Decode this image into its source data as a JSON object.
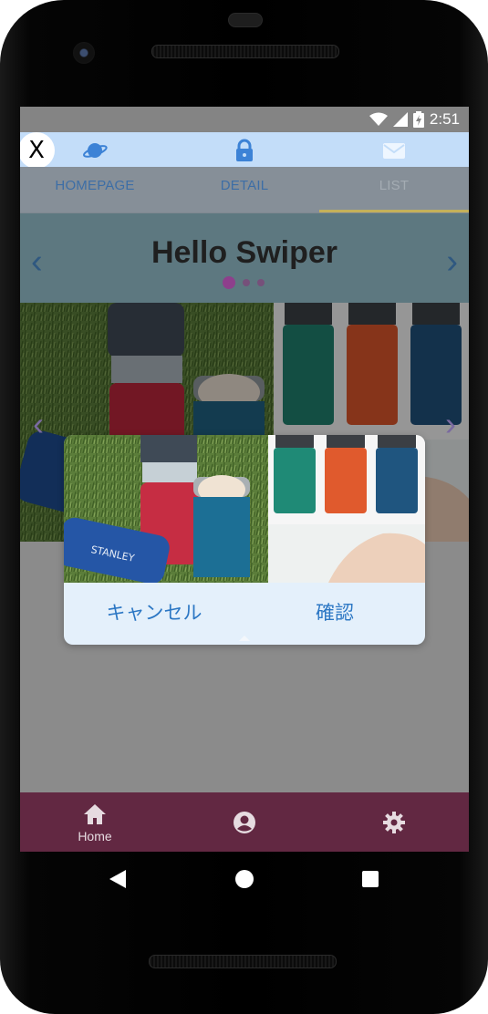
{
  "status_bar": {
    "time": "2:51"
  },
  "top_nav": {
    "close_label": "X",
    "icons": [
      "planet-icon",
      "lock-icon",
      "mail-icon"
    ]
  },
  "tabs": [
    {
      "label": "HOMEPAGE",
      "active": false
    },
    {
      "label": "DETAIL",
      "active": false
    },
    {
      "label": "LIST",
      "active": true
    }
  ],
  "hero": {
    "title": "Hello Swiper",
    "prev_arrow": "‹",
    "next_arrow": "›",
    "pagination": {
      "total": 3,
      "current": 1
    }
  },
  "carousel": {
    "prev_arrow": "‹",
    "next_arrow": "›"
  },
  "dialog": {
    "image_alt": "water bottle product photos",
    "cancel_label": "キャンセル",
    "confirm_label": "確認"
  },
  "bottom_nav": {
    "items": [
      {
        "icon": "home-icon",
        "label": "Home"
      },
      {
        "icon": "account-icon",
        "label": ""
      },
      {
        "icon": "settings-icon",
        "label": ""
      }
    ]
  },
  "system_nav": {
    "buttons": [
      "back-icon",
      "home-circle-icon",
      "recents-icon"
    ]
  },
  "colors": {
    "tab_text": "#3d6ea6",
    "tab_indicator": "#c4b15a",
    "dialog_button_text": "#2c77c4",
    "bottom_nav_bg": "#622842",
    "top_nav_bg": "#c3ddf9"
  }
}
